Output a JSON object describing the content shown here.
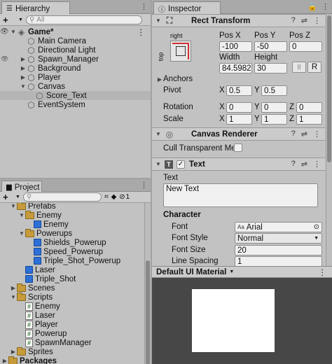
{
  "hierarchy": {
    "tab_label": "Hierarchy",
    "create_label": "+",
    "search_placeholder": "All",
    "scene_name": "Game*",
    "items": [
      {
        "label": "Main Camera"
      },
      {
        "label": "Directional Light"
      },
      {
        "label": "Spawn_Manager"
      },
      {
        "label": "Background"
      },
      {
        "label": "Player"
      },
      {
        "label": "Canvas"
      },
      {
        "label": "Score_Text"
      },
      {
        "label": "EventSystem"
      }
    ]
  },
  "project": {
    "tab_label": "Project",
    "create_label": "+",
    "hidden_count": "1",
    "items": [
      {
        "label": "Prefabs"
      },
      {
        "label": "Enemy"
      },
      {
        "label": "Enemy"
      },
      {
        "label": "Powerups"
      },
      {
        "label": "Shields_Powerup"
      },
      {
        "label": "Speed_Powerup"
      },
      {
        "label": "Triple_Shot_Powerup"
      },
      {
        "label": "Laser"
      },
      {
        "label": "Triple_Shot"
      },
      {
        "label": "Scenes"
      },
      {
        "label": "Scripts"
      },
      {
        "label": "Enemy"
      },
      {
        "label": "Laser"
      },
      {
        "label": "Player"
      },
      {
        "label": "Powerup"
      },
      {
        "label": "SpawnManager"
      },
      {
        "label": "Sprites"
      },
      {
        "label": "Packages"
      }
    ]
  },
  "inspector": {
    "tab_label": "Inspector",
    "rect_transform": {
      "title": "Rect Transform",
      "anchor_h_label": "right",
      "anchor_v_label": "top",
      "pos_x_label": "Pos X",
      "pos_y_label": "Pos Y",
      "pos_z_label": "Pos Z",
      "pos_x": "-100",
      "pos_y": "-50",
      "pos_z": "0",
      "width_label": "Width",
      "height_label": "Height",
      "width": "84.59821",
      "height": "30",
      "r_button": "R",
      "anchors_label": "Anchors",
      "pivot_label": "Pivot",
      "pivot_x": "0.5",
      "pivot_y": "0.5",
      "rotation_label": "Rotation",
      "rot_x": "0",
      "rot_y": "0",
      "rot_z": "0",
      "scale_label": "Scale",
      "scale_x": "1",
      "scale_y": "1",
      "scale_z": "1",
      "x": "X",
      "y": "Y",
      "z": "Z"
    },
    "canvas_renderer": {
      "title": "Canvas Renderer",
      "cull_label": "Cull Transparent Mes"
    },
    "text": {
      "title": "Text",
      "text_label": "Text",
      "text_value": "New Text",
      "character_label": "Character",
      "font_label": "Font",
      "font_value": "Arial",
      "font_prefix": "Aa",
      "font_style_label": "Font Style",
      "font_style_value": "Normal",
      "font_size_label": "Font Size",
      "font_size_value": "20",
      "line_spacing_label": "Line Spacing",
      "line_spacing_value": "1"
    },
    "material": {
      "label": "Default UI Material"
    }
  },
  "colors": {
    "panel_bg": "#c2c2c2",
    "selection": "#b5b5b5",
    "preview_bg": "#474747",
    "script_green": "#3a7a3a",
    "prefab_blue": "#2c6fd6"
  }
}
